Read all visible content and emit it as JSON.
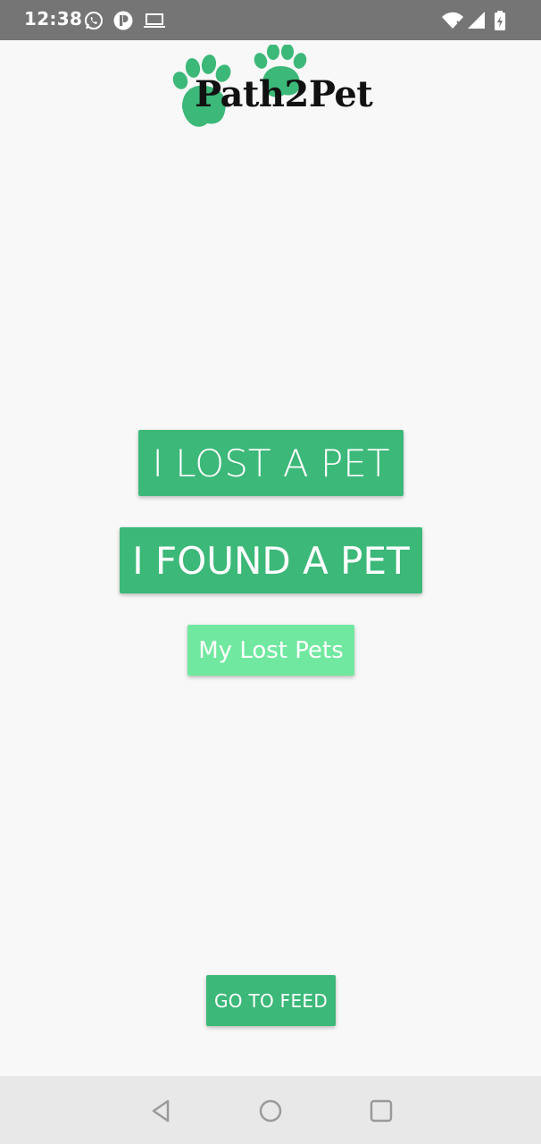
{
  "status_bar": {
    "time": "12:38",
    "left_icons": [
      "whatsapp-icon",
      "app-icon",
      "laptop-icon"
    ],
    "right_icons": [
      "wifi-icon",
      "signal-icon",
      "battery-icon"
    ]
  },
  "logo": {
    "text": "Path2Pet",
    "accent_color": "#3cb878"
  },
  "buttons": {
    "lost_pet": "I LOST A PET",
    "found_pet": "I FOUND A PET",
    "my_lost_pets": "My Lost Pets",
    "go_to_feed": "GO TO FEED"
  },
  "colors": {
    "primary": "#3cb878",
    "secondary": "#71e8a0",
    "status_bar": "#757575",
    "background": "#f7f8f7"
  },
  "nav_bar": {
    "icons": [
      "back-icon",
      "home-icon",
      "recents-icon"
    ]
  }
}
